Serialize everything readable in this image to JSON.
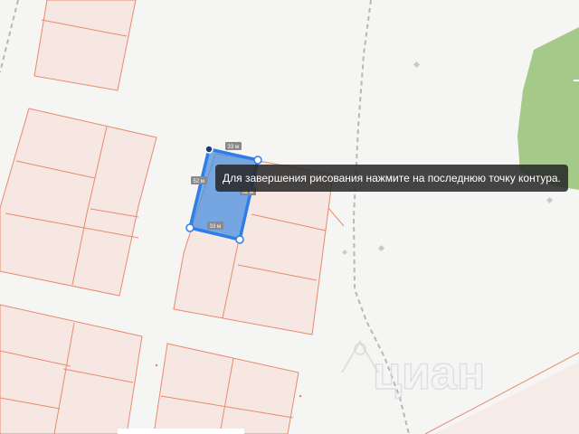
{
  "tooltip": {
    "text": "Для завершения рисования нажмите на последнюю точку контура."
  },
  "measurements": {
    "top_edge": "33 м",
    "right_edge": "52 м",
    "bottom_edge": "33 м",
    "left_edge": "52 м"
  },
  "watermark": {
    "brand": "циан"
  },
  "colors": {
    "parcel_fill": "#f6e7e3",
    "parcel_border": "#e98a6f",
    "drawn_polygon": "#2f7ee6",
    "green_area": "#a5c988",
    "map_background": "#f5f5f4"
  },
  "icons": {
    "watermark": "cian-logo-icon",
    "vertex": "vertex-handle-icon"
  }
}
